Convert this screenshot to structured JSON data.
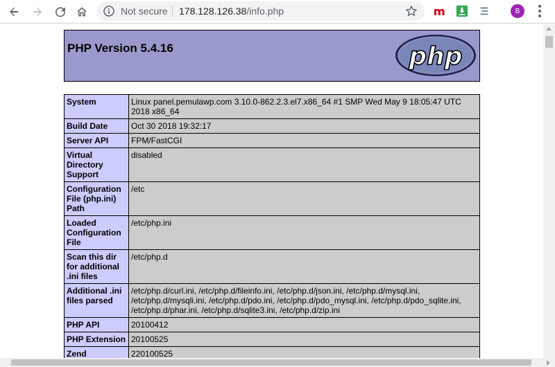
{
  "browser": {
    "security_label": "Not secure",
    "url_host": "178.128.126.38",
    "url_path": "/info.php",
    "profile_initial": "B",
    "extensions": [
      "m-extension-icon",
      "download-extension-icon",
      "list-extension-icon"
    ],
    "colors": {
      "ext_m": "#d6001c",
      "ext_download": "#34a853",
      "avatar": "#9c27b0"
    }
  },
  "page": {
    "title": "PHP Version 5.4.16",
    "logo_text": "php",
    "colors": {
      "header": "#9999cc",
      "label_cell": "#ccccff",
      "value_cell": "#cccccc"
    },
    "rows": [
      {
        "label": "System",
        "value": "Linux panel.pemulawp.com 3.10.0-862.2.3.el7.x86_64 #1 SMP Wed May 9 18:05:47 UTC 2018 x86_64"
      },
      {
        "label": "Build Date",
        "value": "Oct 30 2018 19:32:17"
      },
      {
        "label": "Server API",
        "value": "FPM/FastCGI"
      },
      {
        "label": "Virtual Directory Support",
        "value": "disabled"
      },
      {
        "label": "Configuration File (php.ini) Path",
        "value": "/etc"
      },
      {
        "label": "Loaded Configuration File",
        "value": "/etc/php.ini"
      },
      {
        "label": "Scan this dir for additional .ini files",
        "value": "/etc/php.d"
      },
      {
        "label": "Additional .ini files parsed",
        "value": "/etc/php.d/curl.ini, /etc/php.d/fileinfo.ini, /etc/php.d/json.ini, /etc/php.d/mysql.ini, /etc/php.d/mysqli.ini, /etc/php.d/pdo.ini, /etc/php.d/pdo_mysql.ini, /etc/php.d/pdo_sqlite.ini, /etc/php.d/phar.ini, /etc/php.d/sqlite3.ini, /etc/php.d/zip.ini"
      },
      {
        "label": "PHP API",
        "value": "20100412"
      },
      {
        "label": "PHP Extension",
        "value": "20100525"
      },
      {
        "label": "Zend",
        "value": "220100525"
      }
    ]
  }
}
